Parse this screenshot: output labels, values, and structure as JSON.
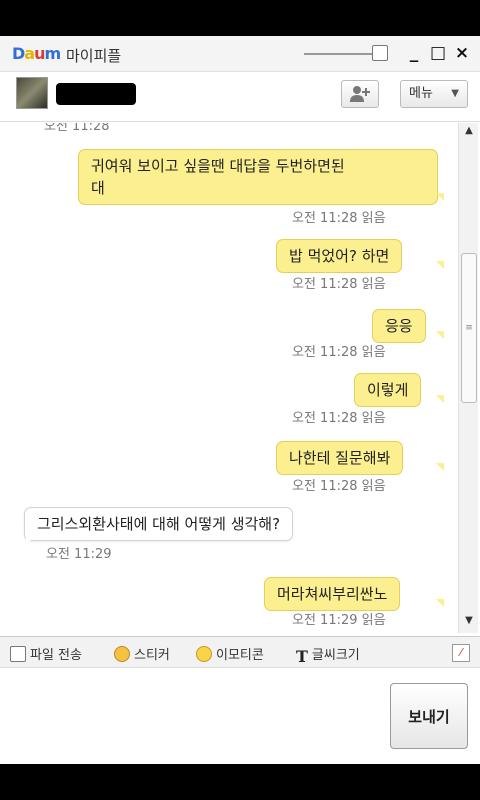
{
  "titlebar": {
    "logo_parts": [
      "D",
      "a",
      "u",
      "m"
    ],
    "app_title": "마이피플",
    "minimize": "_",
    "maximize": "□",
    "close": "×"
  },
  "profile": {
    "add_friend_icon": "user-plus-icon",
    "menu_label": "메뉴",
    "menu_caret": "▼"
  },
  "chat": {
    "cut_timestamp": "오전 11:28",
    "messages": [
      {
        "sender": "me",
        "text_line1": "귀여워 보이고 싶을땐 대답을 두번하면된",
        "text_line2": "대",
        "time": "오전 11:28",
        "status": "읽음"
      },
      {
        "sender": "me",
        "text": "밥 먹었어? 하면",
        "time": "오전 11:28",
        "status": "읽음"
      },
      {
        "sender": "me",
        "text": "응응",
        "time": "오전 11:28",
        "status": "읽음"
      },
      {
        "sender": "me",
        "text": "이렇게",
        "time": "오전 11:28",
        "status": "읽음"
      },
      {
        "sender": "me",
        "text": "나한테 질문해봐",
        "time": "오전 11:28",
        "status": "읽음"
      },
      {
        "sender": "them",
        "text": "그리스외환사태에 대해 어떻게 생각해?",
        "time": "오전 11:29"
      },
      {
        "sender": "me",
        "text": "머라쳐씨부리싼노",
        "time": "오전 11:29",
        "status": "읽음"
      }
    ]
  },
  "toolbar": {
    "file_transfer": "파일 전송",
    "sticker": "스티커",
    "emoticon": "이모티콘",
    "font_size": "글씨크기",
    "font_icon_glyph": "T"
  },
  "input": {
    "placeholder": "",
    "send_label": "보내기"
  },
  "colors": {
    "my_bubble": "#fcef8f",
    "their_bubble": "#ffffff",
    "meta_text": "#777777"
  }
}
